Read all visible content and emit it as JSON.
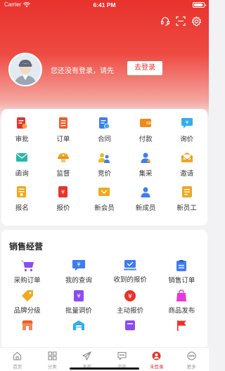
{
  "status_bar": {
    "carrier": "Carrier",
    "time": "6:41 PM"
  },
  "header": {
    "login_prompt": "您还没有登录，请先",
    "login_button": "去登录"
  },
  "quick_grid": [
    {
      "label": "审批",
      "icon": "approval-icon",
      "color": "#e8322c"
    },
    {
      "label": "订单",
      "icon": "order-icon",
      "color": "#f05a28"
    },
    {
      "label": "合同",
      "icon": "contract-icon",
      "color": "#3d7cf3"
    },
    {
      "label": "付款",
      "icon": "wallet-icon",
      "color": "#f08a1c"
    },
    {
      "label": "询价",
      "icon": "inquiry-icon",
      "color": "#2eaef0"
    },
    {
      "label": "函询",
      "icon": "mail-icon",
      "color": "#2bb5a8"
    },
    {
      "label": "监督",
      "icon": "supervision-icon",
      "color": "#f0a81c"
    },
    {
      "label": "竞价",
      "icon": "bidding-icon",
      "color": "#f0b81c"
    },
    {
      "label": "集采",
      "icon": "group-buy-icon",
      "color": "#3d7cf3"
    },
    {
      "label": "邀请",
      "icon": "invite-icon",
      "color": "#f0a81c"
    },
    {
      "label": "报名",
      "icon": "signup-icon",
      "color": "#f0a81c"
    },
    {
      "label": "报价",
      "icon": "quote-icon",
      "color": "#e8322c"
    },
    {
      "label": "新会员",
      "icon": "new-member-icon",
      "color": "#f0a81c"
    },
    {
      "label": "新成员",
      "icon": "new-person-icon",
      "color": "#3d7cf3"
    },
    {
      "label": "新员工",
      "icon": "new-staff-icon",
      "color": "#f0a81c"
    }
  ],
  "sales": {
    "title": "销售经营",
    "items": [
      {
        "label": "采购订单",
        "icon": "cart-icon",
        "color": "#8b4df0"
      },
      {
        "label": "我的查询",
        "icon": "my-query-icon",
        "color": "#3d7cf3"
      },
      {
        "label": "收到的报价",
        "icon": "received-quote-icon",
        "color": "#3d7cf3"
      },
      {
        "label": "销售订单",
        "icon": "sales-order-icon",
        "color": "#3d7cf3"
      },
      {
        "label": "品牌分级",
        "icon": "brand-tag-icon",
        "color": "#f0a81c"
      },
      {
        "label": "批量调价",
        "icon": "batch-price-icon",
        "color": "#8b4df0"
      },
      {
        "label": "主动报价",
        "icon": "active-quote-icon",
        "color": "#e8322c"
      },
      {
        "label": "商品发布",
        "icon": "goods-publish-icon",
        "color": "#e83ad8"
      },
      {
        "label": "",
        "icon": "shop-icon",
        "color": "#f05a28"
      },
      {
        "label": "",
        "icon": "warehouse-icon",
        "color": "#2eaef0"
      },
      {
        "label": "",
        "icon": "purple-task-icon",
        "color": "#8b4df0"
      },
      {
        "label": "",
        "icon": "flag-icon",
        "color": "#e8322c"
      }
    ]
  },
  "tabbar": [
    {
      "label": "首页",
      "icon": "home-icon",
      "active": false
    },
    {
      "label": "分类",
      "icon": "category-icon",
      "active": false
    },
    {
      "label": "发布",
      "icon": "publish-icon",
      "active": false
    },
    {
      "label": "消息",
      "icon": "message-icon",
      "active": false
    },
    {
      "label": "未登录",
      "icon": "user-icon",
      "active": true
    },
    {
      "label": "更多",
      "icon": "more-icon",
      "active": false
    }
  ]
}
